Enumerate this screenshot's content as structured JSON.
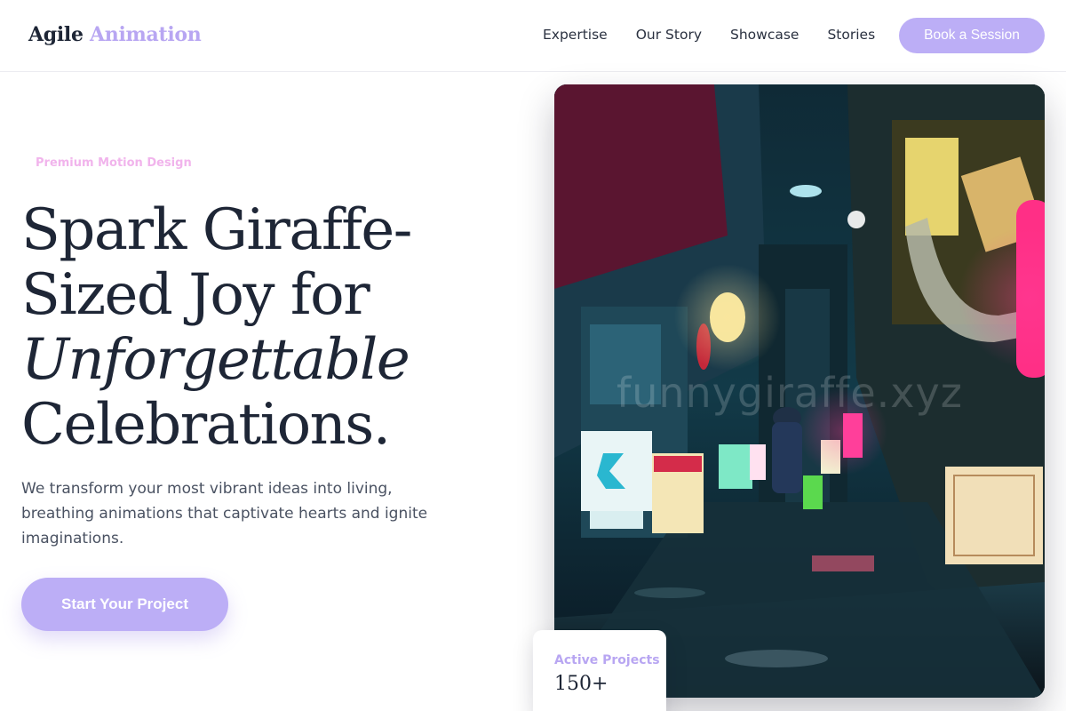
{
  "brand": {
    "name_part1": "Agile",
    "name_part2": "Animation"
  },
  "nav": {
    "items": [
      {
        "label": "Expertise"
      },
      {
        "label": "Our Story"
      },
      {
        "label": "Showcase"
      },
      {
        "label": "Stories"
      }
    ],
    "cta_label": "Book a Session"
  },
  "hero": {
    "eyebrow": "Premium Motion Design",
    "headline_line1": "Spark Giraffe-",
    "headline_line2": "Sized Joy for",
    "headline_italic": "Unforgettable",
    "headline_line4": "Celebrations.",
    "description": "We transform your most vibrant ideas into living, breathing animations that captivate hearts and ignite imaginations.",
    "cta_label": "Start Your Project",
    "image_watermark": "funnygiraffe.xyz"
  },
  "stats": {
    "label": "Active Projects",
    "value": "150+"
  },
  "colors": {
    "accent": "#bcaef6",
    "brand_accent": "#b8a6f2",
    "eyebrow": "#f1b4ec",
    "text": "#1e2636"
  }
}
